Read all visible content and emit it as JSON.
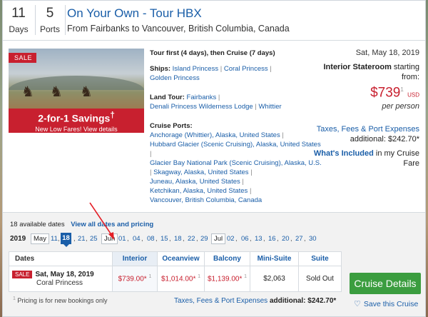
{
  "header": {
    "days_value": "11",
    "days_label": "Days",
    "ports_value": "5",
    "ports_label": "Ports",
    "title": "On Your Own - Tour HBX",
    "route": "From Fairbanks to Vancouver, British Columbia, Canada"
  },
  "hero": {
    "sale_tag": "SALE",
    "promo_big": "2-for-1 Savings",
    "promo_sup": "†",
    "promo_small": "New Low Fares! View details"
  },
  "itinerary": {
    "tour_line": "Tour first (4 days), then Cruise (7 days)",
    "ships_label": "Ships:",
    "ships": [
      "Island Princess",
      "Coral Princess",
      "Golden Princess"
    ],
    "land_label": "Land Tour:",
    "land": [
      "Fairbanks",
      "Denali Princess Wilderness Lodge",
      "Whittier"
    ],
    "ports_label": "Cruise Ports:",
    "ports": [
      "Anchorage (Whittier), Alaska, United States",
      "Hubbard Glacier (Scenic Cruising), Alaska, United States",
      "Glacier Bay National Park (Scenic Cruising), Alaska, U.S.",
      "Skagway, Alaska, United States",
      "Juneau, Alaska, United States",
      "Ketchikan, Alaska, United States",
      "Vancouver, British Columbia, Canada"
    ]
  },
  "pricing": {
    "date": "Sat, May 18, 2019",
    "room_type": "Interior Stateroom",
    "starting_from": "starting from:",
    "price": "$739",
    "price_sup": "1",
    "currency": "USD",
    "per_person": "per person",
    "fees_link": "Taxes, Fees & Port Expenses",
    "additional": "additional: $242.70*",
    "included_link": "What's Included",
    "included_suffix": "in my Cruise Fare"
  },
  "dates_section": {
    "available": "18 available dates",
    "view_all": "View all dates and pricing",
    "year": "2019",
    "months": {
      "may": "May",
      "jun": "Jun",
      "jul": "Jul"
    },
    "may_days": [
      "11",
      "18",
      "21",
      "25"
    ],
    "jun_days": [
      "01",
      "04",
      "08",
      "15",
      "18",
      "22",
      "29"
    ],
    "jul_days": [
      "02",
      "06",
      "13",
      "16",
      "20",
      "27",
      "30"
    ],
    "table": {
      "headers": [
        "Dates",
        "Interior",
        "Oceanview",
        "Balcony",
        "Mini-Suite",
        "Suite"
      ],
      "row": {
        "sale": "SALE",
        "date": "Sat, May 18, 2019",
        "ship": "Coral Princess",
        "interior": "$739.00*",
        "oceanview": "$1,014.00*",
        "balcony": "$1,139.00*",
        "mini_suite": "$2,063",
        "suite": "Sold Out"
      }
    },
    "note": "Pricing is for new bookings only",
    "note_sup": "1",
    "fees_link": "Taxes, Fees & Port Expenses",
    "fees_additional": "additional: $242.70*",
    "cruise_details": "Cruise Details",
    "save": "Save this Cruise"
  },
  "colors": {
    "link": "#1a5ea8",
    "sale_red": "#c8202f",
    "button_green": "#3b9d3f"
  }
}
